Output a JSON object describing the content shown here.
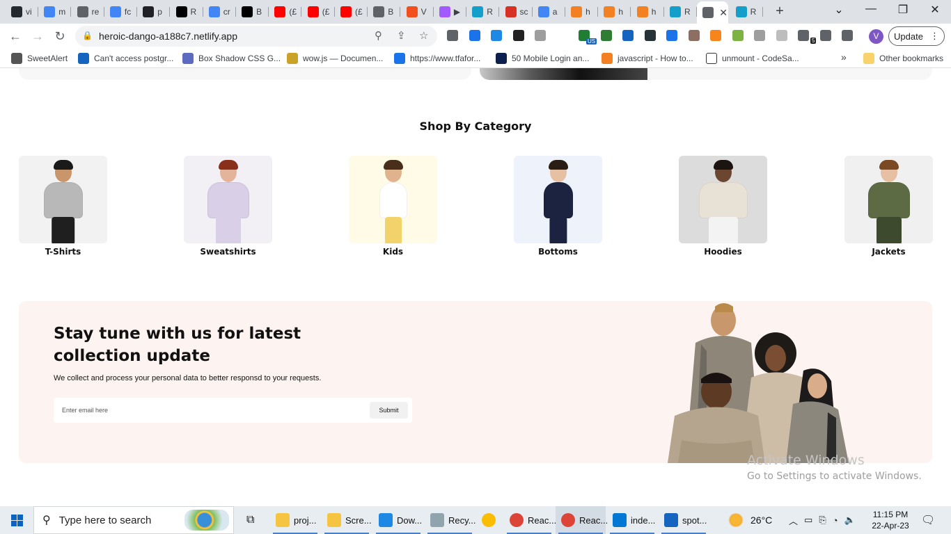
{
  "browser": {
    "tabs": [
      {
        "label": "vi",
        "icon": "github-icon",
        "color": "#24292f"
      },
      {
        "label": "m",
        "icon": "google-icon",
        "color": "#4285f4"
      },
      {
        "label": "re",
        "icon": "globe-icon",
        "color": "#5f6368"
      },
      {
        "label": "fc",
        "icon": "google-icon",
        "color": "#4285f4"
      },
      {
        "label": "p",
        "icon": "square-icon",
        "color": "#202124"
      },
      {
        "label": "R",
        "icon": "r-box-icon",
        "color": "#000000"
      },
      {
        "label": "cr",
        "icon": "google-icon",
        "color": "#4285f4"
      },
      {
        "label": "B",
        "icon": "medium-icon",
        "color": "#000000"
      },
      {
        "label": "(£",
        "icon": "youtube-icon",
        "color": "#ff0000"
      },
      {
        "label": "(£",
        "icon": "youtube-icon",
        "color": "#ff0000"
      },
      {
        "label": "(£",
        "icon": "youtube-icon",
        "color": "#ff0000"
      },
      {
        "label": "B",
        "icon": "hand-icon",
        "color": "#5f6368"
      },
      {
        "label": "V",
        "icon": "figma-icon",
        "color": "#f24e1e"
      },
      {
        "label": "▶",
        "icon": "figma-icon",
        "color": "#a259ff"
      },
      {
        "label": "R",
        "icon": "react-icon",
        "color": "#149eca"
      },
      {
        "label": "sc",
        "icon": "asterisk-icon",
        "color": "#d93025"
      },
      {
        "label": "a",
        "icon": "google-icon",
        "color": "#4285f4"
      },
      {
        "label": "h",
        "icon": "stackoverflow-icon",
        "color": "#f48024"
      },
      {
        "label": "h",
        "icon": "stackoverflow-icon",
        "color": "#f48024"
      },
      {
        "label": "h",
        "icon": "stackoverflow-icon",
        "color": "#f48024"
      },
      {
        "label": "R",
        "icon": "react-icon",
        "color": "#149eca"
      },
      {
        "label": "",
        "icon": "globe-icon",
        "color": "#5f6368",
        "active": true
      },
      {
        "label": "R",
        "icon": "react-icon",
        "color": "#149eca"
      }
    ],
    "url": "heroic-dango-a188c7.netlify.app",
    "update_label": "Update",
    "profile_initial": "V",
    "extension_badge": "5",
    "extension_us": "US",
    "bookmarks": [
      {
        "label": "SweetAlert",
        "color": "#555555"
      },
      {
        "label": "Can't access postgr...",
        "color": "#1565c0"
      },
      {
        "label": "Box Shadow CSS G...",
        "color": "#5c6bc0"
      },
      {
        "label": "wow.js — Documen...",
        "color": "#c9a227"
      },
      {
        "label": "https://www.tfafor...",
        "color": "#1a73e8"
      },
      {
        "label": "50 Mobile Login an...",
        "color": "#0d1f4c"
      },
      {
        "label": "javascript - How to...",
        "color": "#f48024"
      },
      {
        "label": "unmount - CodeSa...",
        "color": "#ffffff"
      }
    ],
    "bookmarks_overflow": "»",
    "other_bookmarks": "Other bookmarks"
  },
  "page": {
    "section_title": "Shop By Category",
    "categories": [
      {
        "label": "T-Shirts",
        "bg": "#f2f2f2"
      },
      {
        "label": "Sweatshirts",
        "bg": "#f3f0f5"
      },
      {
        "label": "Kids",
        "bg": "#fffbe6"
      },
      {
        "label": "Bottoms",
        "bg": "#eef3fb"
      },
      {
        "label": "Hoodies",
        "bg": "#dcdcdc"
      },
      {
        "label": "Jackets",
        "bg": "#f0f0f0"
      }
    ],
    "newsletter": {
      "title": "Stay tune with us for latest collection update",
      "description": "We collect and process your personal data to better responsd to your requests.",
      "email_placeholder": "Enter email here",
      "submit_label": "Submit",
      "bg": "#fdf4f1"
    }
  },
  "os": {
    "watermark_title": "Activate Windows",
    "watermark_sub": "Go to Settings to activate Windows.",
    "search_placeholder": "Type here to search",
    "taskbar_items": [
      {
        "label": "proj...",
        "color": "#f5c542"
      },
      {
        "label": "Scre...",
        "color": "#f5c542"
      },
      {
        "label": "Dow...",
        "color": "#1e88e5"
      },
      {
        "label": "Recy...",
        "color": "#90a4ae"
      },
      {
        "label": "",
        "color": "#fbbc04"
      },
      {
        "label": "Reac...",
        "color": "#db4437"
      },
      {
        "label": "Reac...",
        "color": "#db4437"
      },
      {
        "label": "inde...",
        "color": "#0078d4"
      },
      {
        "label": "spot...",
        "color": "#1565c0"
      }
    ],
    "weather": "26°C",
    "time": "11:15 PM",
    "date": "22-Apr-23"
  }
}
